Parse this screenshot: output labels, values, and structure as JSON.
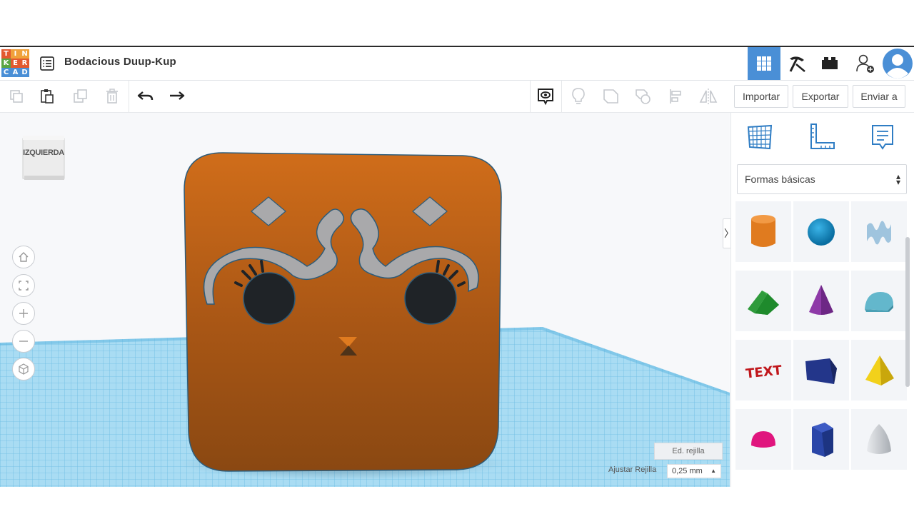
{
  "app": {
    "logo_letters": [
      "T",
      "I",
      "N",
      "K",
      "E",
      "R",
      "C",
      "A",
      "D"
    ],
    "logo_colors": [
      "#e2592f",
      "#f0a13a",
      "#f0a13a",
      "#5aa544",
      "#e2592f",
      "#e2592f",
      "#4a8fd6",
      "#4a8fd6",
      "#4a8fd6"
    ],
    "project_title": "Bodacious Duup-Kup",
    "accent": "#4a8fd6"
  },
  "toolbar": {
    "import_label": "Importar",
    "export_label": "Exportar",
    "send_label": "Enviar a"
  },
  "viewport": {
    "view_cube_label": "IZQUIERDA",
    "edit_grid_label": "Ed. rejilla",
    "snap_grid_label": "Ajustar Rejilla",
    "snap_grid_value": "0,25 mm",
    "model_color": "#c8671a",
    "grid_color": "#7ec8ea"
  },
  "panel": {
    "library_select": "Formas básicas",
    "shape_names": [
      "cylinder",
      "sphere",
      "scribble",
      "roof",
      "cone",
      "round-roof",
      "text",
      "box-wedge",
      "pyramid",
      "half-sphere",
      "polygon",
      "paraboloid"
    ],
    "shape_text_label": "TEXT"
  }
}
